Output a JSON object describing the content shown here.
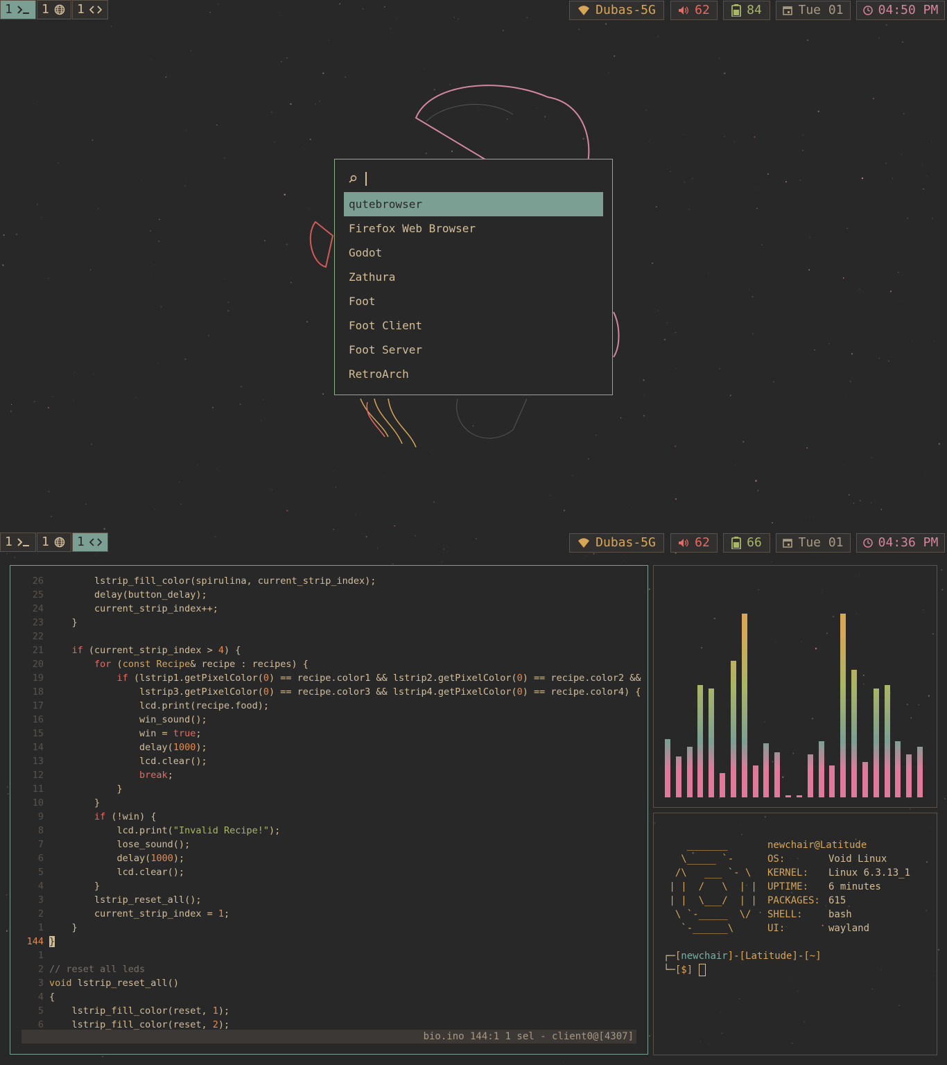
{
  "colors": {
    "bg": "#282828",
    "accent": "#7c9f93",
    "yellow": "#d8a657",
    "red": "#ea6962",
    "pink": "#e07a9a"
  },
  "workspaces": [
    {
      "num": "1",
      "icon": "terminal-icon"
    },
    {
      "num": "1",
      "icon": "globe-icon"
    },
    {
      "num": "1",
      "icon": "code-icon"
    }
  ],
  "top_bar": {
    "wifi": "Dubas-5G",
    "volume": "62",
    "battery": "84",
    "date": "Tue 01",
    "time": "04:50 PM"
  },
  "bottom_bar": {
    "wifi": "Dubas-5G",
    "volume": "62",
    "battery": "66",
    "date": "Tue 01",
    "time": "04:36 PM"
  },
  "launcher": {
    "query": "",
    "items": [
      "qutebrowser",
      "Firefox Web Browser",
      "Godot",
      "Zathura",
      "Foot",
      "Foot Client",
      "Foot Server",
      "RetroArch"
    ]
  },
  "editor": {
    "status": "bio.ino 144:1  1 sel - client0@[4307]",
    "lines": [
      {
        "n": "26",
        "t": "        lstrip_fill_color(spirulina, current_strip_index);"
      },
      {
        "n": "25",
        "t": "        delay(button_delay);"
      },
      {
        "n": "24",
        "t": "        current_strip_index++;"
      },
      {
        "n": "23",
        "t": "    }"
      },
      {
        "n": "22",
        "t": ""
      },
      {
        "n": "21",
        "t": "    if (current_strip_index > 4) {"
      },
      {
        "n": "20",
        "t": "        for (const Recipe& recipe : recipes) {"
      },
      {
        "n": "19",
        "t": "            if (lstrip1.getPixelColor(0) == recipe.color1 && lstrip2.getPixelColor(0) == recipe.color2 &&"
      },
      {
        "n": "18",
        "t": "                lstrip3.getPixelColor(0) == recipe.color3 && lstrip4.getPixelColor(0) == recipe.color4) {"
      },
      {
        "n": "17",
        "t": "                lcd.print(recipe.food);"
      },
      {
        "n": "16",
        "t": "                win_sound();"
      },
      {
        "n": "15",
        "t": "                win = true;"
      },
      {
        "n": "14",
        "t": "                delay(1000);"
      },
      {
        "n": "13",
        "t": "                lcd.clear();"
      },
      {
        "n": "12",
        "t": "                break;"
      },
      {
        "n": "11",
        "t": "            }"
      },
      {
        "n": "10",
        "t": "        }"
      },
      {
        "n": "9",
        "t": "        if (!win) {"
      },
      {
        "n": "8",
        "t": "            lcd.print(\"Invalid Recipe!\");"
      },
      {
        "n": "7",
        "t": "            lose_sound();"
      },
      {
        "n": "6",
        "t": "            delay(1000);"
      },
      {
        "n": "5",
        "t": "            lcd.clear();"
      },
      {
        "n": "4",
        "t": "        }"
      },
      {
        "n": "3",
        "t": "        lstrip_reset_all();"
      },
      {
        "n": "2",
        "t": "        current_strip_index = 1;"
      },
      {
        "n": "1",
        "t": "    }"
      },
      {
        "n": "144",
        "t": "}"
      },
      {
        "n": "1",
        "t": ""
      },
      {
        "n": "2",
        "t": "// reset all leds"
      },
      {
        "n": "3",
        "t": "void lstrip_reset_all()"
      },
      {
        "n": "4",
        "t": "{"
      },
      {
        "n": "5",
        "t": "    lstrip_fill_color(reset, 1);"
      },
      {
        "n": "6",
        "t": "    lstrip_fill_color(reset, 2);"
      }
    ]
  },
  "visualizer": {
    "levels": [
      0.31,
      0.22,
      0.27,
      0.6,
      0.58,
      0.13,
      0.73,
      0.98,
      0.17,
      0.29,
      0.24,
      0.01,
      0.01,
      0.23,
      0.3,
      0.17,
      0.98,
      0.68,
      0.19,
      0.58,
      0.6,
      0.3,
      0.23,
      0.27
    ]
  },
  "fetch": {
    "ascii": [
      "    _______",
      "   \\_____ `-",
      "  /\\   ___ `- \\",
      " | |  /   \\  | |",
      " | |  \\___/  | |",
      "  \\ `-_____  \\/",
      "   `-______\\"
    ],
    "user": "newchair@Latitude",
    "rows": [
      {
        "k": "OS:",
        "v": "Void Linux"
      },
      {
        "k": "KERNEL:",
        "v": "Linux 6.3.13_1"
      },
      {
        "k": "UPTIME:",
        "v": "6 minutes"
      },
      {
        "k": "PACKAGES:",
        "v": "615"
      },
      {
        "k": "SHELL:",
        "v": "bash"
      },
      {
        "k": "UI:",
        "v": "wayland"
      }
    ],
    "prompt_user": "newchair",
    "prompt_host": "Latitude",
    "prompt_dir": "~",
    "prompt_sym": "$"
  }
}
